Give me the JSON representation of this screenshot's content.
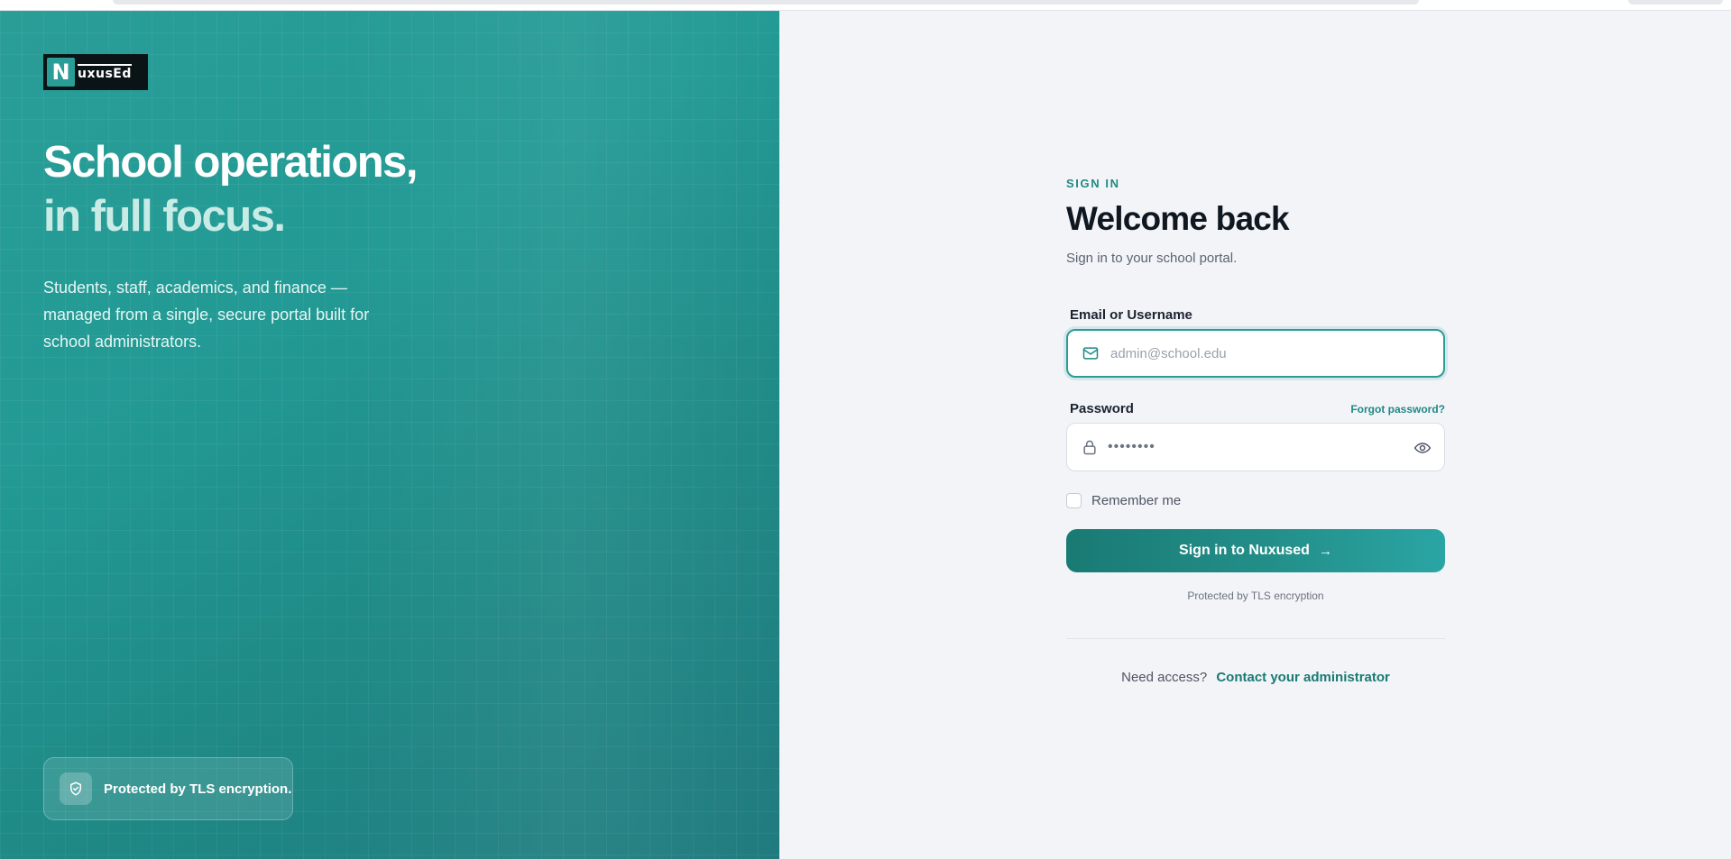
{
  "brand": {
    "logo_letter": "N",
    "logo_text": "uxusEd"
  },
  "hero": {
    "headline_line1": "School operations,",
    "headline_line2": "in full focus.",
    "description": "Students, staff, academics, and finance — managed from a single, secure portal built for school administrators.",
    "badge_text": "Protected by TLS encryption."
  },
  "form": {
    "eyebrow": "SIGN IN",
    "title": "Welcome back",
    "subtitle": "Sign in to your school portal.",
    "email": {
      "label": "Email or Username",
      "placeholder": "admin@school.edu",
      "value": ""
    },
    "password": {
      "label": "Password",
      "forgot_link": "Forgot password?",
      "masked_value": "••••••••"
    },
    "remember_label": "Remember me",
    "remember_checked": false,
    "submit_label": "Sign in to Nuxused",
    "submit_arrow": "→",
    "tls_note": "Protected by TLS encryption",
    "access_prompt": "Need access?",
    "access_link": "Contact your administrator"
  },
  "colors": {
    "accent": "#2a9d97",
    "accent_dark": "#1a7a74",
    "hero_bg": "#239a95",
    "page_bg": "#f3f4f8"
  }
}
